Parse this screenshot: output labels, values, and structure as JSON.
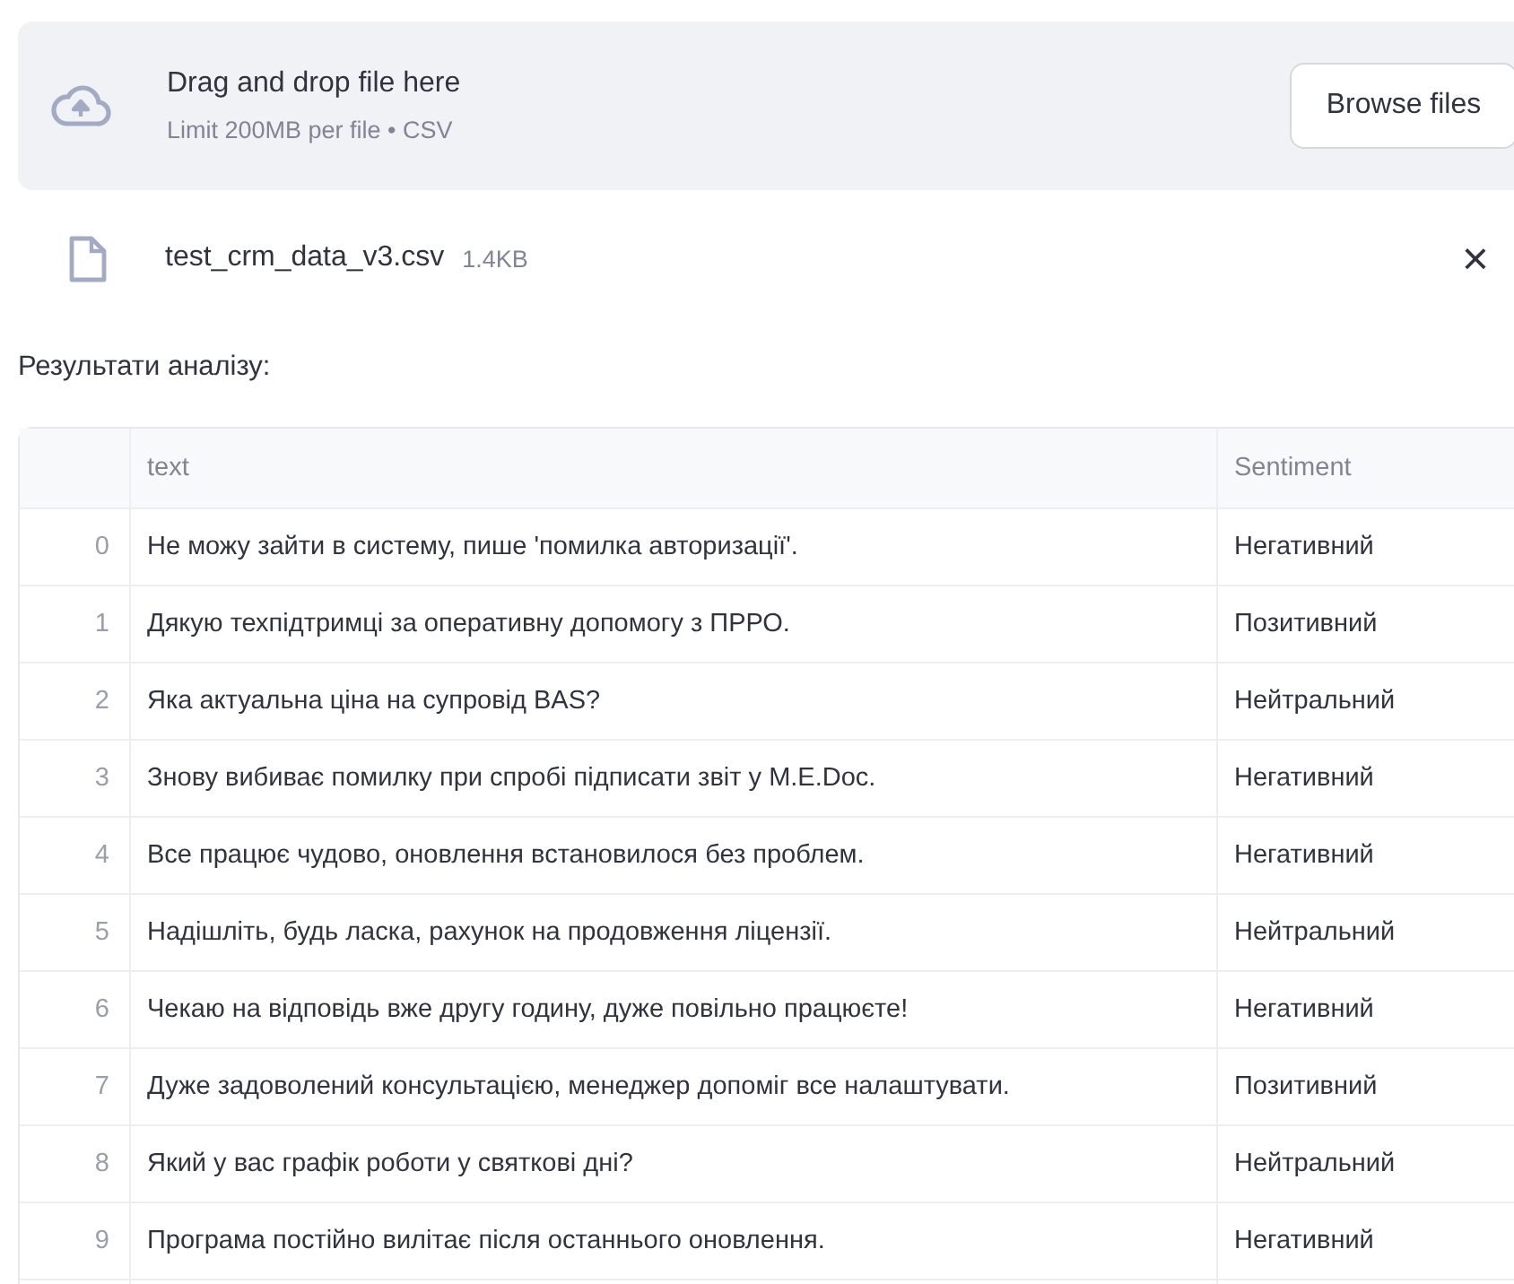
{
  "uploader": {
    "title": "Drag and drop file here",
    "hint": "Limit 200MB per file • CSV",
    "button": "Browse files"
  },
  "file": {
    "name": "test_crm_data_v3.csv",
    "size": "1.4KB",
    "remove": "×"
  },
  "heading": "Результати аналізу:",
  "table": {
    "columns": [
      "text",
      "Sentiment"
    ],
    "rows": [
      {
        "index": "0",
        "text": "Не можу зайти в систему, пише 'помилка авторизації'.",
        "sentiment": "Негативний"
      },
      {
        "index": "1",
        "text": "Дякую техпідтримці за оперативну допомогу з ПРРО.",
        "sentiment": "Позитивний"
      },
      {
        "index": "2",
        "text": "Яка актуальна ціна на супровід BAS?",
        "sentiment": "Нейтральний"
      },
      {
        "index": "3",
        "text": "Знову вибиває помилку при спробі підписати звіт у M.E.Doc.",
        "sentiment": "Негативний"
      },
      {
        "index": "4",
        "text": "Все працює чудово, оновлення встановилося без проблем.",
        "sentiment": "Негативний"
      },
      {
        "index": "5",
        "text": "Надішліть, будь ласка, рахунок на продовження ліцензії.",
        "sentiment": "Нейтральний"
      },
      {
        "index": "6",
        "text": "Чекаю на відповідь вже другу годину, дуже повільно працюєте!",
        "sentiment": "Негативний"
      },
      {
        "index": "7",
        "text": "Дуже задоволений консультацією, менеджер допоміг все налаштувати.",
        "sentiment": "Позитивний"
      },
      {
        "index": "8",
        "text": "Який у вас графік роботи у святкові дні?",
        "sentiment": "Нейтральний"
      },
      {
        "index": "9",
        "text": "Програма постійно вилітає після останнього оновлення.",
        "sentiment": "Негативний"
      }
    ]
  }
}
